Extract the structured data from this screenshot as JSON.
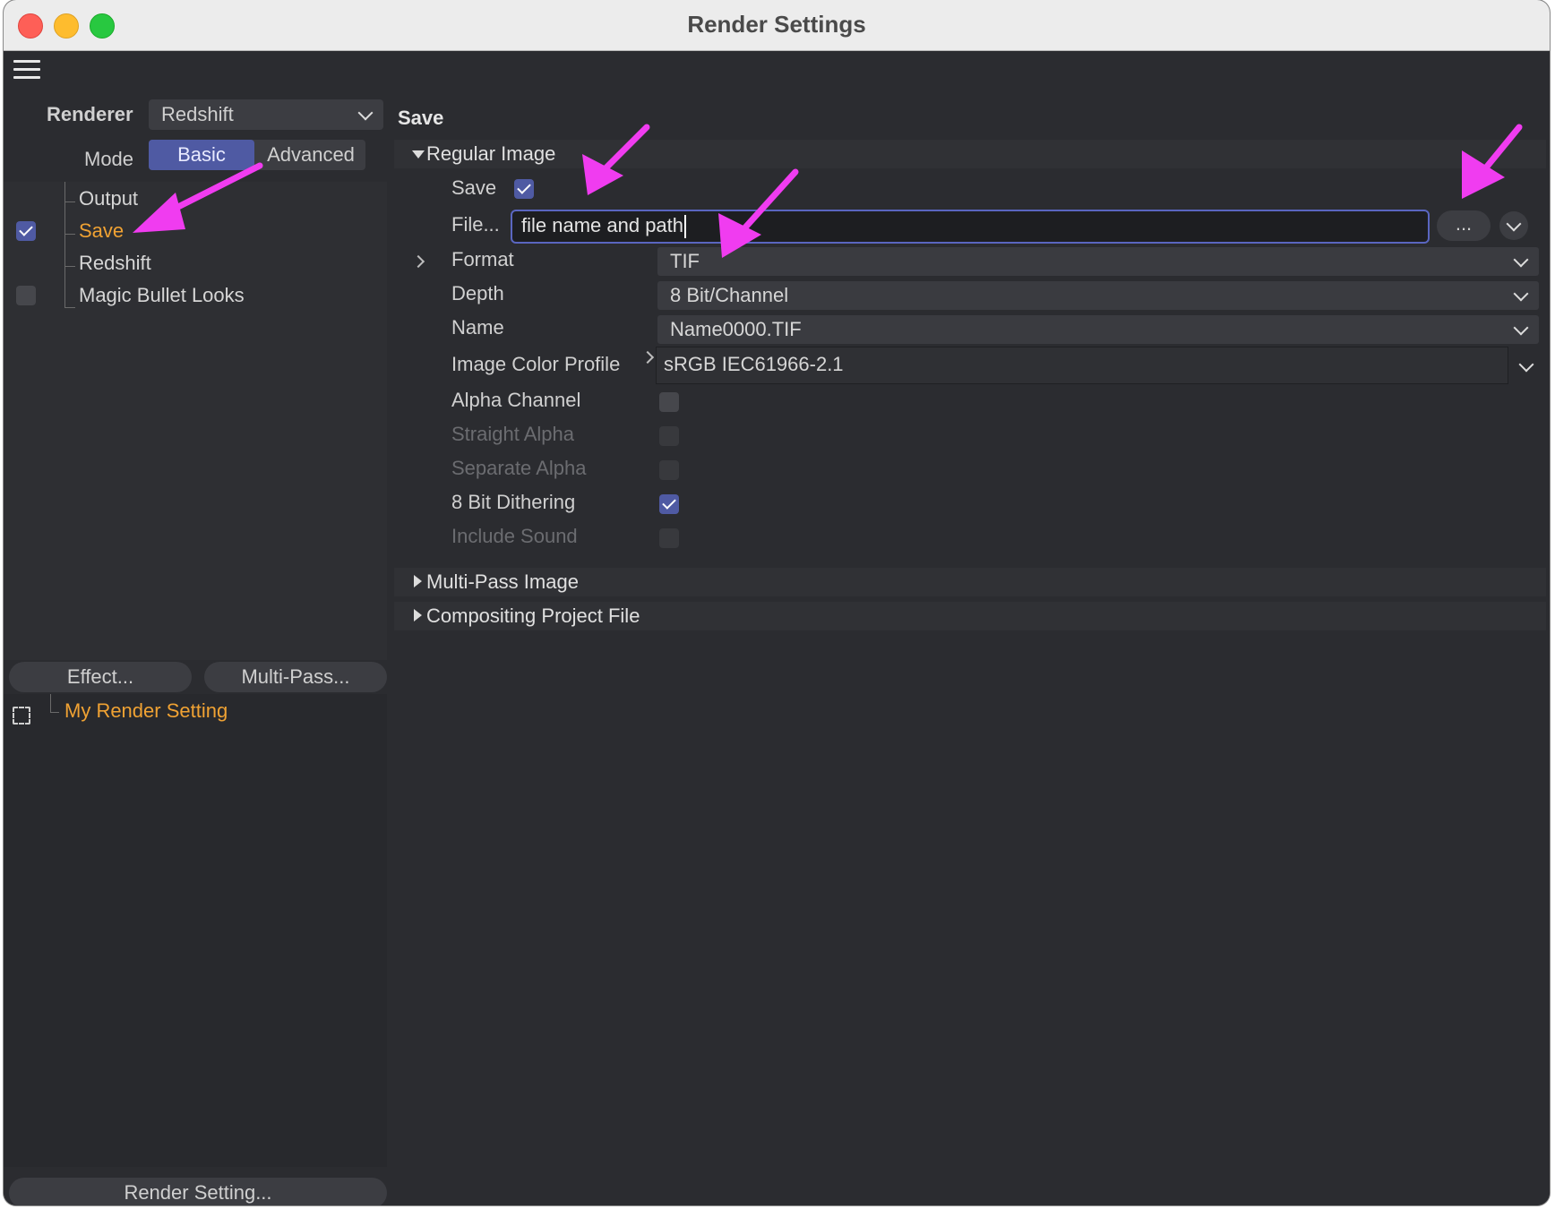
{
  "window": {
    "title": "Render Settings"
  },
  "toolbar": {
    "menu_icon": "hamburger-menu-icon"
  },
  "left": {
    "renderer_label": "Renderer",
    "renderer_value": "Redshift",
    "mode_label": "Mode",
    "mode_basic": "Basic",
    "mode_advanced": "Advanced",
    "tree": [
      {
        "label": "Output",
        "checkbox": "none",
        "active": false
      },
      {
        "label": "Save",
        "checkbox": "checked",
        "active": true
      },
      {
        "label": "Redshift",
        "checkbox": "none",
        "active": false
      },
      {
        "label": "Magic Bullet Looks",
        "checkbox": "unchecked",
        "active": false
      }
    ],
    "effect_button": "Effect...",
    "multipass_button": "Multi-Pass...",
    "scene_name": "My Render Setting",
    "render_setting_button": "Render Setting..."
  },
  "right": {
    "section_title": "Save",
    "regular_image": {
      "group_label": "Regular Image",
      "save_label": "Save",
      "save_checked": true,
      "file_label": "File...",
      "file_value": "file name and path",
      "browse_button": "...",
      "format_label": "Format",
      "format_value": "TIF",
      "depth_label": "Depth",
      "depth_value": "8 Bit/Channel",
      "name_label": "Name",
      "name_value": "Name0000.TIF",
      "profile_label": "Image Color Profile",
      "profile_value": "sRGB IEC61966-2.1",
      "alpha_channel_label": "Alpha Channel",
      "alpha_channel_checked": false,
      "straight_alpha_label": "Straight Alpha",
      "straight_alpha_checked": false,
      "separate_alpha_label": "Separate Alpha",
      "separate_alpha_checked": false,
      "dithering_label": "8 Bit Dithering",
      "dithering_checked": true,
      "include_sound_label": "Include Sound",
      "include_sound_checked": false
    },
    "multipass_group": "Multi-Pass Image",
    "compositing_group": "Compositing Project File"
  },
  "colors": {
    "accent": "#4f5aa3",
    "active_text": "#f0a233",
    "annotation_arrow": "#f03cf0",
    "background": "#2b2c30"
  }
}
